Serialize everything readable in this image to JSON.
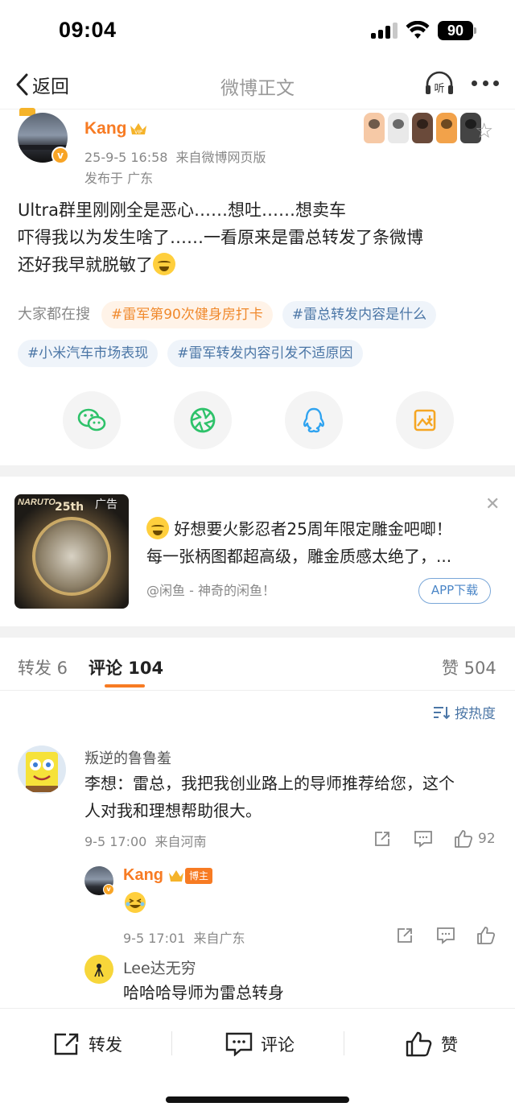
{
  "status_bar": {
    "time": "09:04",
    "battery": "90"
  },
  "nav": {
    "back_label": "返回",
    "title": "微博正文",
    "listen_label": "听"
  },
  "post": {
    "author": "Kang",
    "timestamp": "25-9-5 16:58",
    "source": "来自微博网页版",
    "location": "发布于 广东",
    "lines": [
      "Ultra群里刚刚全是恶心……想吐……想卖车",
      "吓得我以为发生啥了……一看原来是雷总转发了条微博",
      "还好我早就脱敏了"
    ]
  },
  "hot_search": {
    "label": "大家都在搜",
    "tags": [
      {
        "text": "#雷军第90次健身房打卡",
        "hot": true
      },
      {
        "text": "#雷总转发内容是什么",
        "hot": false
      },
      {
        "text": "#小米汽车市场表现",
        "hot": false
      },
      {
        "text": "#雷军转发内容引发不适原因",
        "hot": false
      }
    ]
  },
  "share": [
    "wechat-icon",
    "moments-icon",
    "qq-icon",
    "save-image-icon"
  ],
  "ad": {
    "tag": "广告",
    "image_brand": "NARUTO",
    "image_badge": "25th",
    "line1": "好想要火影忍者25周年限定雕金吧唧！",
    "line2": "每一张柄图都超高级，雕金质感太绝了，...",
    "source": "@闲鱼 - 神奇的闲鱼！",
    "download": "APP下载"
  },
  "tabs": {
    "repost": "转发 6",
    "comments": "评论 104",
    "likes": "赞 504"
  },
  "sort_label": "按热度",
  "comments": [
    {
      "name": "叛逆的鲁鲁羞",
      "text_line1": "李想：雷总，我把我创业路上的导师推荐给您，这个",
      "text_line2": "人对我和理想帮助很大。",
      "meta": "9-5 17:00  来自河南",
      "likes": "92"
    },
    {
      "name": "Kang",
      "badge": "博主",
      "meta": "9-5 17:01  来自广东"
    },
    {
      "name": "Lee达无穷",
      "text": "哈哈哈导师为雷总转身"
    }
  ],
  "bottom": {
    "repost": "转发",
    "comment": "评论",
    "like": "赞"
  },
  "colors": {
    "accent": "#f77b23",
    "link": "#4b76a6",
    "hot_tag_bg": "#fff3e8",
    "tag_bg": "#eff4fa"
  }
}
